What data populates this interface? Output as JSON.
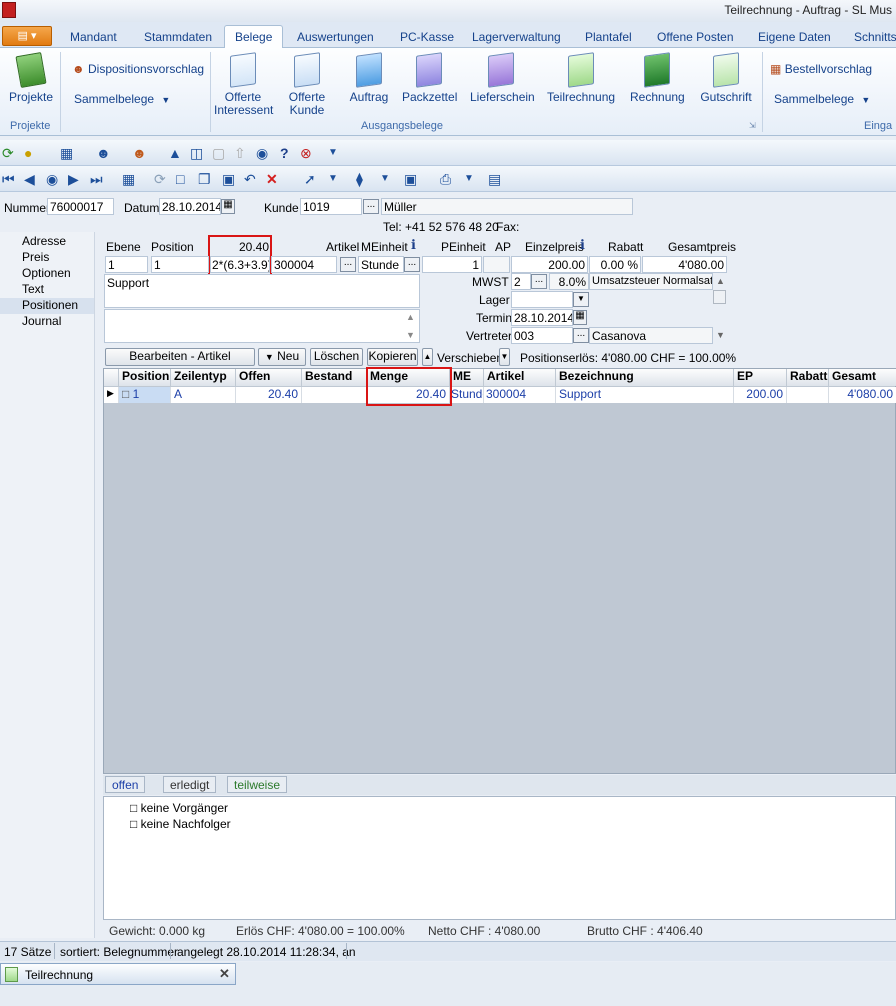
{
  "window": {
    "title": "Teilrechnung - Auftrag - SL Mus"
  },
  "ribbon_tabs": [
    "Mandant",
    "Stammdaten",
    "Belege",
    "Auswertungen",
    "PC-Kasse",
    "Lagerverwaltung",
    "Plantafel",
    "Offene Posten",
    "Eigene Daten",
    "Schnitts"
  ],
  "ribbon": {
    "projekte": "Projekte",
    "dispositionsvorschlag": "Dispositionsvorschlag",
    "sammelbelege": "Sammelbelege",
    "offerte_interessent": "Offerte\nInteressent",
    "offerte_kunde": "Offerte\nKunde",
    "auftrag": "Auftrag",
    "packzettel": "Packzettel",
    "lieferschein": "Lieferschein",
    "teilrechnung": "Teilrechnung",
    "rechnung": "Rechnung",
    "gutschrift": "Gutschrift",
    "bestellvorschlag": "Bestellvorschlag",
    "sammelbelege2": "Sammelbelege",
    "group_projekte": "Projekte",
    "group_ausgang": "Ausgangsbelege",
    "group_eingang": "Einga"
  },
  "header": {
    "nummer_label": "Nummer",
    "nummer": "76000017",
    "datum_label": "Datum",
    "datum": "28.10.2014",
    "kunde_label": "Kunde",
    "kunde": "1019",
    "kunde_name": "Müller",
    "tel": "Tel: +41 52 576 48 20",
    "fax": "Fax:"
  },
  "leftnav": [
    "Adresse",
    "Preis",
    "Optionen",
    "Text",
    "Positionen",
    "Journal"
  ],
  "detail": {
    "labels": {
      "ebene": "Ebene",
      "position": "Position",
      "menge_value": "20.40",
      "artikel": "Artikel",
      "meinheit": "MEinheit",
      "peinheit": "PEinheit",
      "ap": "AP",
      "einzelpreis": "Einzelpreis",
      "rabatt": "Rabatt",
      "gesamtpreis": "Gesamtpreis"
    },
    "values": {
      "ebene": "1",
      "position": "1",
      "formel": "2*(6.3+3.9)",
      "artikel": "300004",
      "meinheit": "Stunde",
      "peinheit": "1",
      "einzelpreis": "200.00",
      "rabatt": "0.00 %",
      "gesamtpreis": "4'080.00"
    },
    "text": "Support",
    "mwst_label": "MWST",
    "mwst_code": "2",
    "mwst_rate": "8.0%",
    "mwst_desc": "Umsatzsteuer Normalsatz",
    "lager_label": "Lager",
    "termin_label": "Termin",
    "termin": "28.10.2014",
    "vertreter_label": "Vertreter",
    "vertreter": "003",
    "vertreter_name": "Casanova"
  },
  "actions": {
    "bearbeiten": "Bearbeiten - Artikel",
    "neu": "Neu",
    "loeschen": "Löschen",
    "kopieren": "Kopieren",
    "verschieben": "Verschieben",
    "positionserloes": "Positionserlös:  4'080.00 CHF = 100.00%"
  },
  "grid": {
    "columns": [
      "Position",
      "Zeilentyp",
      "Offen",
      "Bestand",
      "Menge",
      "ME",
      "Artikel",
      "Bezeichnung",
      "EP",
      "Rabatt",
      "Gesamt"
    ],
    "rows": [
      {
        "position": "1",
        "zeilentyp": "A",
        "offen": "20.40",
        "bestand": "",
        "menge": "20.40",
        "me": "Stunde",
        "artikel": "300004",
        "bezeichnung": "Support",
        "ep": "200.00",
        "rabatt": "",
        "gesamt": "4'080.00"
      }
    ]
  },
  "bottom_tabs": [
    "offen",
    "erledigt",
    "teilweise"
  ],
  "tree": [
    "keine Vorgänger",
    "keine Nachfolger"
  ],
  "totals": {
    "gewicht": "Gewicht:  0.000 kg",
    "erloes": "Erlös CHF: 4'080.00 = 100.00%",
    "netto": "Netto CHF : 4'080.00",
    "brutto": "Brutto CHF : 4'406.40"
  },
  "status": {
    "count": "17 Sätze",
    "sort": "sortiert: Belegnummer",
    "created": "angelegt 28.10.2014 11:28:34, an"
  },
  "taskbar": {
    "tab": "Teilrechnung"
  },
  "colors": {
    "highlight": "#d91515",
    "accent": "#15428b"
  }
}
